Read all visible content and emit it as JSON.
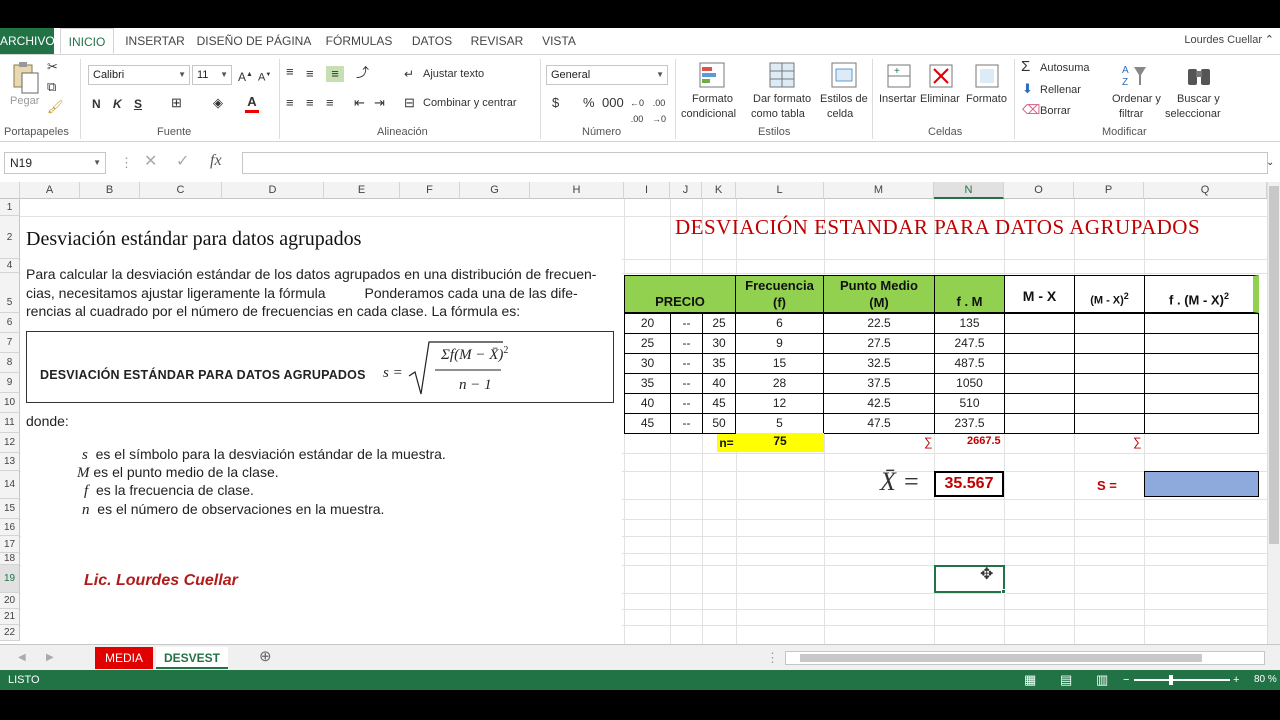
{
  "ribbon_tabs": [
    "ARCHIVO",
    "INICIO",
    "INSERTAR",
    "DISEÑO DE PÁGINA",
    "FÓRMULAS",
    "DATOS",
    "REVISAR",
    "VISTA"
  ],
  "user": "Lourdes Cuellar",
  "ribbon": {
    "paste": "Pegar",
    "font_name": "Calibri",
    "font_size": "11",
    "wrap_text": "Ajustar texto",
    "merge_center": "Combinar y centrar",
    "number_format": "General",
    "cond_format": [
      "Formato",
      "condicional"
    ],
    "table_format": [
      "Dar formato",
      "como tabla"
    ],
    "cell_styles": [
      "Estilos de",
      "celda"
    ],
    "insert": "Insertar",
    "delete": "Eliminar",
    "format": "Formato",
    "autosum": "Autosuma",
    "fill": "Rellenar",
    "clear": "Borrar",
    "sort_filter": [
      "Ordenar y",
      "filtrar"
    ],
    "find_select": [
      "Buscar y",
      "seleccionar"
    ],
    "groups": [
      "Portapapeles",
      "Fuente",
      "Alineación",
      "Número",
      "Estilos",
      "Celdas",
      "Modificar"
    ]
  },
  "formula_bar": {
    "name_box": "N19",
    "fx": "fx",
    "value": ""
  },
  "columns": [
    "A",
    "B",
    "C",
    "D",
    "E",
    "F",
    "G",
    "H",
    "I",
    "J",
    "K",
    "L",
    "M",
    "N",
    "O",
    "P",
    "Q"
  ],
  "rows": [
    "1",
    "2",
    "4",
    "5",
    "6",
    "7",
    "8",
    "9",
    "10",
    "11",
    "12",
    "13",
    "14",
    "15",
    "16",
    "17",
    "18",
    "19",
    "20",
    "21",
    "22"
  ],
  "sheet": {
    "left_title": "Desviación estándar para datos agrupados",
    "paragraph_lines": [
      "Para calcular la desviación estándar de los datos agrupados en una distribución de frecuen-",
      "cias, necesitamos ajustar ligeramente la fórmula          Ponderamos cada una de las dife-",
      "rencias al cuadrado por el número de frecuencias en cada clase. La fórmula es:"
    ],
    "formula_label": "DESVIACIÓN ESTÁNDAR PARA DATOS AGRUPADOS",
    "formula_s": "s =",
    "formula_num": "Σf(M − X̄)",
    "formula_exp": "2",
    "formula_den": "n − 1",
    "donde": "donde:",
    "definitions": [
      {
        "sym": "s",
        "text": "es el símbolo para la desviación estándar de la muestra."
      },
      {
        "sym": "M",
        "text": "es el punto medio de la clase."
      },
      {
        "sym": "f",
        "text": "es la frecuencia de clase."
      },
      {
        "sym": "n",
        "text": "es el número de observaciones en la muestra."
      }
    ],
    "author": "Lic. Lourdes Cuellar",
    "right_title": "DESVIACIÓN ESTANDAR PARA DATOS AGRUPADOS"
  },
  "table": {
    "headers": {
      "precio": "PRECIO",
      "frecuencia": [
        "Frecuencia",
        "(f)"
      ],
      "punto_medio": [
        "Punto Medio",
        "(M)"
      ],
      "fm": "f . M",
      "m_minus_x": "M - X",
      "sq": "(M - X)",
      "sq_exp": "2",
      "fsq": "f . (M - X)",
      "fsq_exp": "2"
    },
    "rows": [
      {
        "lo": "20",
        "sep": "--",
        "hi": "25",
        "f": "6",
        "m": "22.5",
        "fm": "135"
      },
      {
        "lo": "25",
        "sep": "--",
        "hi": "30",
        "f": "9",
        "m": "27.5",
        "fm": "247.5"
      },
      {
        "lo": "30",
        "sep": "--",
        "hi": "35",
        "f": "15",
        "m": "32.5",
        "fm": "487.5"
      },
      {
        "lo": "35",
        "sep": "--",
        "hi": "40",
        "f": "28",
        "m": "37.5",
        "fm": "1050"
      },
      {
        "lo": "40",
        "sep": "--",
        "hi": "45",
        "f": "12",
        "m": "42.5",
        "fm": "510"
      },
      {
        "lo": "45",
        "sep": "--",
        "hi": "50",
        "f": "5",
        "m": "47.5",
        "fm": "237.5"
      }
    ],
    "n_label": "n=",
    "n_value": "75",
    "sigma1": "∑",
    "sum_fm": "2667.5",
    "sigma2": "∑",
    "mean_label": "X̄ =",
    "mean_value": "35.567",
    "s_label": "S ="
  },
  "sheet_tabs": [
    "MEDIA",
    "DESVEST"
  ],
  "status": {
    "ready": "LISTO",
    "zoom": "80 %"
  },
  "colors": {
    "excel_green": "#217346",
    "header_green": "#92d050",
    "title_red": "#c00000",
    "s_cell_blue": "#8ea9db",
    "n_yellow": "#ffff00"
  }
}
